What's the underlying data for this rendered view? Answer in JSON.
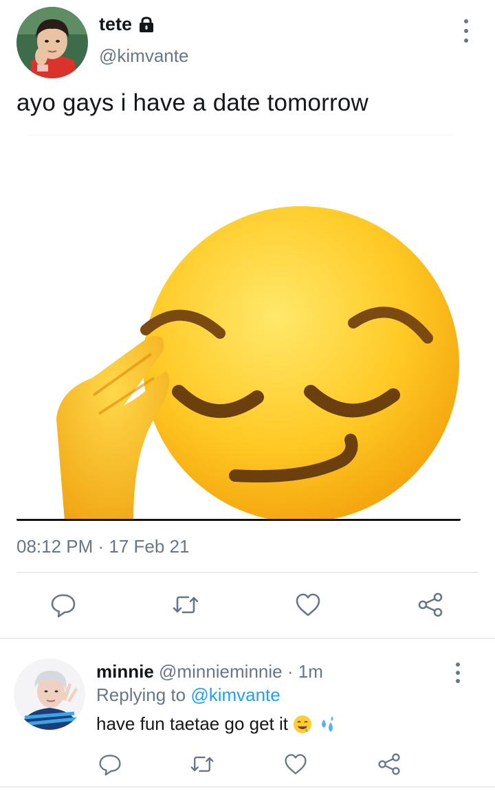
{
  "tweet": {
    "author_name": "tete",
    "author_handle": "@kimvante",
    "locked": true,
    "text": "ayo gays i have a date tomorrow",
    "timestamp": "08:12 PM · 17 Feb 21",
    "media": {
      "type": "emoji-image",
      "emoji_name": "smirking-saluting-face"
    },
    "actions": [
      "reply-icon",
      "retweet-icon",
      "like-icon",
      "share-icon"
    ]
  },
  "reply": {
    "author_name": "minnie",
    "author_handle": "@minnieminnie",
    "separator": "·",
    "time": "1m",
    "replying_prefix": "Replying to",
    "replying_to": "@kimvante",
    "text": "have fun taetae go get it",
    "emojis": [
      "drooling-face-emoji",
      "sweat-droplets-emoji"
    ],
    "actions": [
      "reply-icon",
      "retweet-icon",
      "like-icon",
      "share-icon"
    ]
  },
  "colors": {
    "text_primary": "#14171a",
    "text_secondary": "#657786",
    "link": "#1da1f2",
    "divider": "#e6ecf0"
  }
}
